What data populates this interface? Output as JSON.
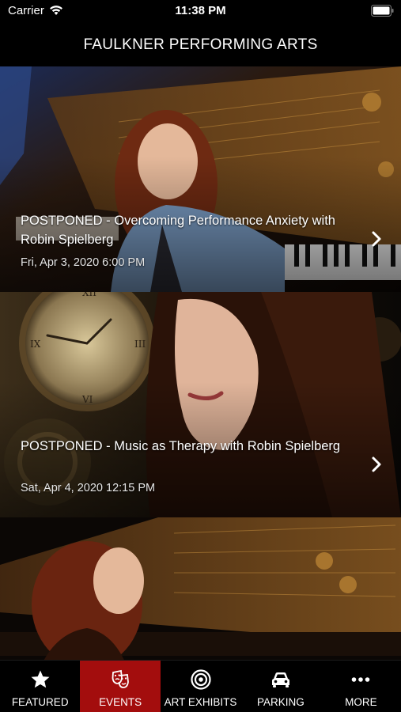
{
  "status": {
    "carrier": "Carrier",
    "time": "11:38 PM"
  },
  "header": {
    "title": "FAULKNER PERFORMING ARTS"
  },
  "events": [
    {
      "title": "POSTPONED - Overcoming Performance Anxiety with Robin Spielberg",
      "date": "Fri, Apr 3, 2020 6:00 PM"
    },
    {
      "title": "POSTPONED - Music as Therapy with Robin Spielberg",
      "date": "Sat, Apr 4, 2020 12:15 PM"
    }
  ],
  "tabs": [
    {
      "label": "FEATURED",
      "icon": "star-icon"
    },
    {
      "label": "EVENTS",
      "icon": "drama-masks-icon"
    },
    {
      "label": "ART EXHIBITS",
      "icon": "target-icon"
    },
    {
      "label": "PARKING",
      "icon": "car-icon"
    },
    {
      "label": "MORE",
      "icon": "more-dots-icon"
    }
  ],
  "colors": {
    "accent": "#a30d0d",
    "background": "#000000",
    "text": "#ffffff"
  }
}
